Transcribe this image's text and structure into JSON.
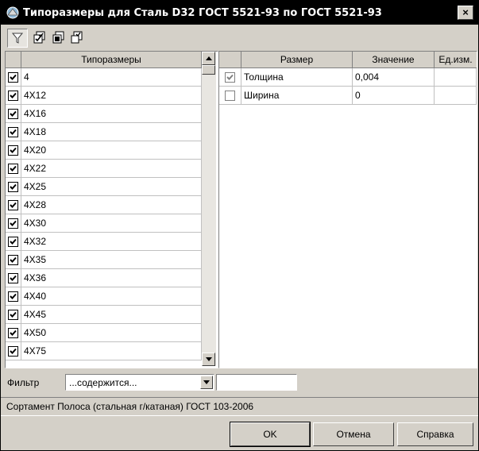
{
  "window": {
    "title": "Типоразмеры для Сталь D32 ГОСТ 5521-93 по ГОСТ 5521-93",
    "close_label": "×"
  },
  "toolbar": {
    "buttons": [
      "filter-icon",
      "check-all-icon",
      "uncheck-all-icon",
      "toggle-check-icon"
    ]
  },
  "left_table": {
    "header": "Типоразмеры",
    "rows": [
      {
        "label": "4",
        "checked": true
      },
      {
        "label": "4X12",
        "checked": true
      },
      {
        "label": "4X16",
        "checked": true
      },
      {
        "label": "4X18",
        "checked": true
      },
      {
        "label": "4X20",
        "checked": true
      },
      {
        "label": "4X22",
        "checked": true
      },
      {
        "label": "4X25",
        "checked": true
      },
      {
        "label": "4X28",
        "checked": true
      },
      {
        "label": "4X30",
        "checked": true
      },
      {
        "label": "4X32",
        "checked": true
      },
      {
        "label": "4X35",
        "checked": true
      },
      {
        "label": "4X36",
        "checked": true
      },
      {
        "label": "4X40",
        "checked": true
      },
      {
        "label": "4X45",
        "checked": true
      },
      {
        "label": "4X50",
        "checked": true
      },
      {
        "label": "4X75",
        "checked": true
      }
    ]
  },
  "right_table": {
    "headers": [
      "Размер",
      "Значение",
      "Ед.изм."
    ],
    "rows": [
      {
        "name": "Толщина",
        "value": "0,004",
        "unit": "",
        "checked": true
      },
      {
        "name": "Ширина",
        "value": "0",
        "unit": "",
        "checked": false
      }
    ]
  },
  "filter": {
    "label": "Фильтр",
    "mode": "...содержится...",
    "text": ""
  },
  "status": {
    "text": "Сортамент Полоса (стальная г/катаная) ГОСТ 103-2006"
  },
  "buttons": {
    "ok": "OK",
    "cancel": "Отмена",
    "help": "Справка"
  },
  "colors": {
    "titlebar": "#000000",
    "face": "#d4d0c8"
  }
}
